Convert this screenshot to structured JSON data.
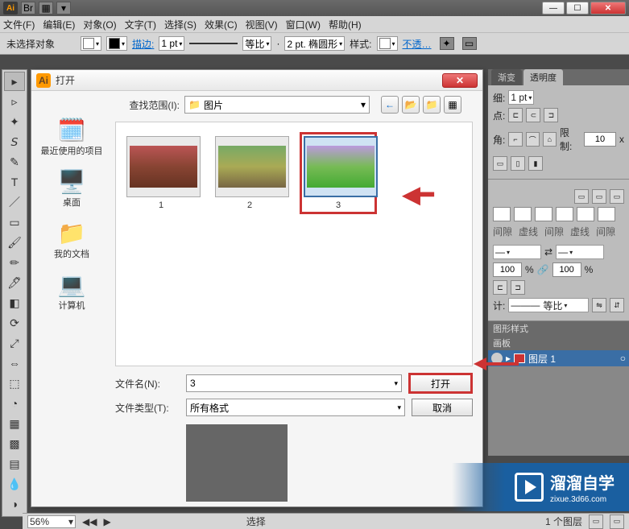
{
  "app": {
    "logo": "Ai"
  },
  "menu": {
    "file": "文件(F)",
    "edit": "编辑(E)",
    "object": "对象(O)",
    "type": "文字(T)",
    "select": "选择(S)",
    "effect": "效果(C)",
    "view": "视图(V)",
    "window": "窗口(W)",
    "help": "帮助(H)"
  },
  "options": {
    "no_selection": "未选择对象",
    "stroke_label": "描边:",
    "stroke_value": "1 pt",
    "proportion": "等比",
    "cap_value": "2 pt. 椭圆形",
    "style_label": "样式:",
    "opacity": "不透…"
  },
  "dialog": {
    "title": "打开",
    "lookin_label": "查找范围(I):",
    "lookin_value": "图片",
    "files": [
      {
        "name": "1"
      },
      {
        "name": "2"
      },
      {
        "name": "3"
      }
    ],
    "filename_label": "文件名(N):",
    "filename_value": "3",
    "filetype_label": "文件类型(T):",
    "filetype_value": "所有格式",
    "open_btn": "打开",
    "cancel_btn": "取消"
  },
  "sidebar": {
    "recent": "最近使用的项目",
    "desktop": "桌面",
    "mydocs": "我的文档",
    "computer": "计算机"
  },
  "panels": {
    "gradient_tab": "渐变",
    "transparency_tab": "透明度",
    "stroke_value": "1 pt",
    "limit_label": "限制:",
    "limit_value": "10",
    "dash": "虚线",
    "gap": "间隙",
    "pct100_a": "100",
    "pct100_b": "100",
    "proportion": "等比",
    "gfx_styles": "图形样式",
    "artboards": "画板",
    "layers_label": "图层 1"
  },
  "status": {
    "zoom": "56%",
    "arrow": "▶",
    "select": "选择",
    "frame": "1 个图层"
  },
  "watermark": {
    "brand": "溜溜自学",
    "url": "zixue.3d66.com"
  },
  "glyph": {
    "x": "✕",
    "min": "—",
    "max": "☐",
    "tri": "▾",
    "triR": "▸",
    "back": "←",
    "up": "↑",
    "star": "★",
    "grid": "▦"
  }
}
